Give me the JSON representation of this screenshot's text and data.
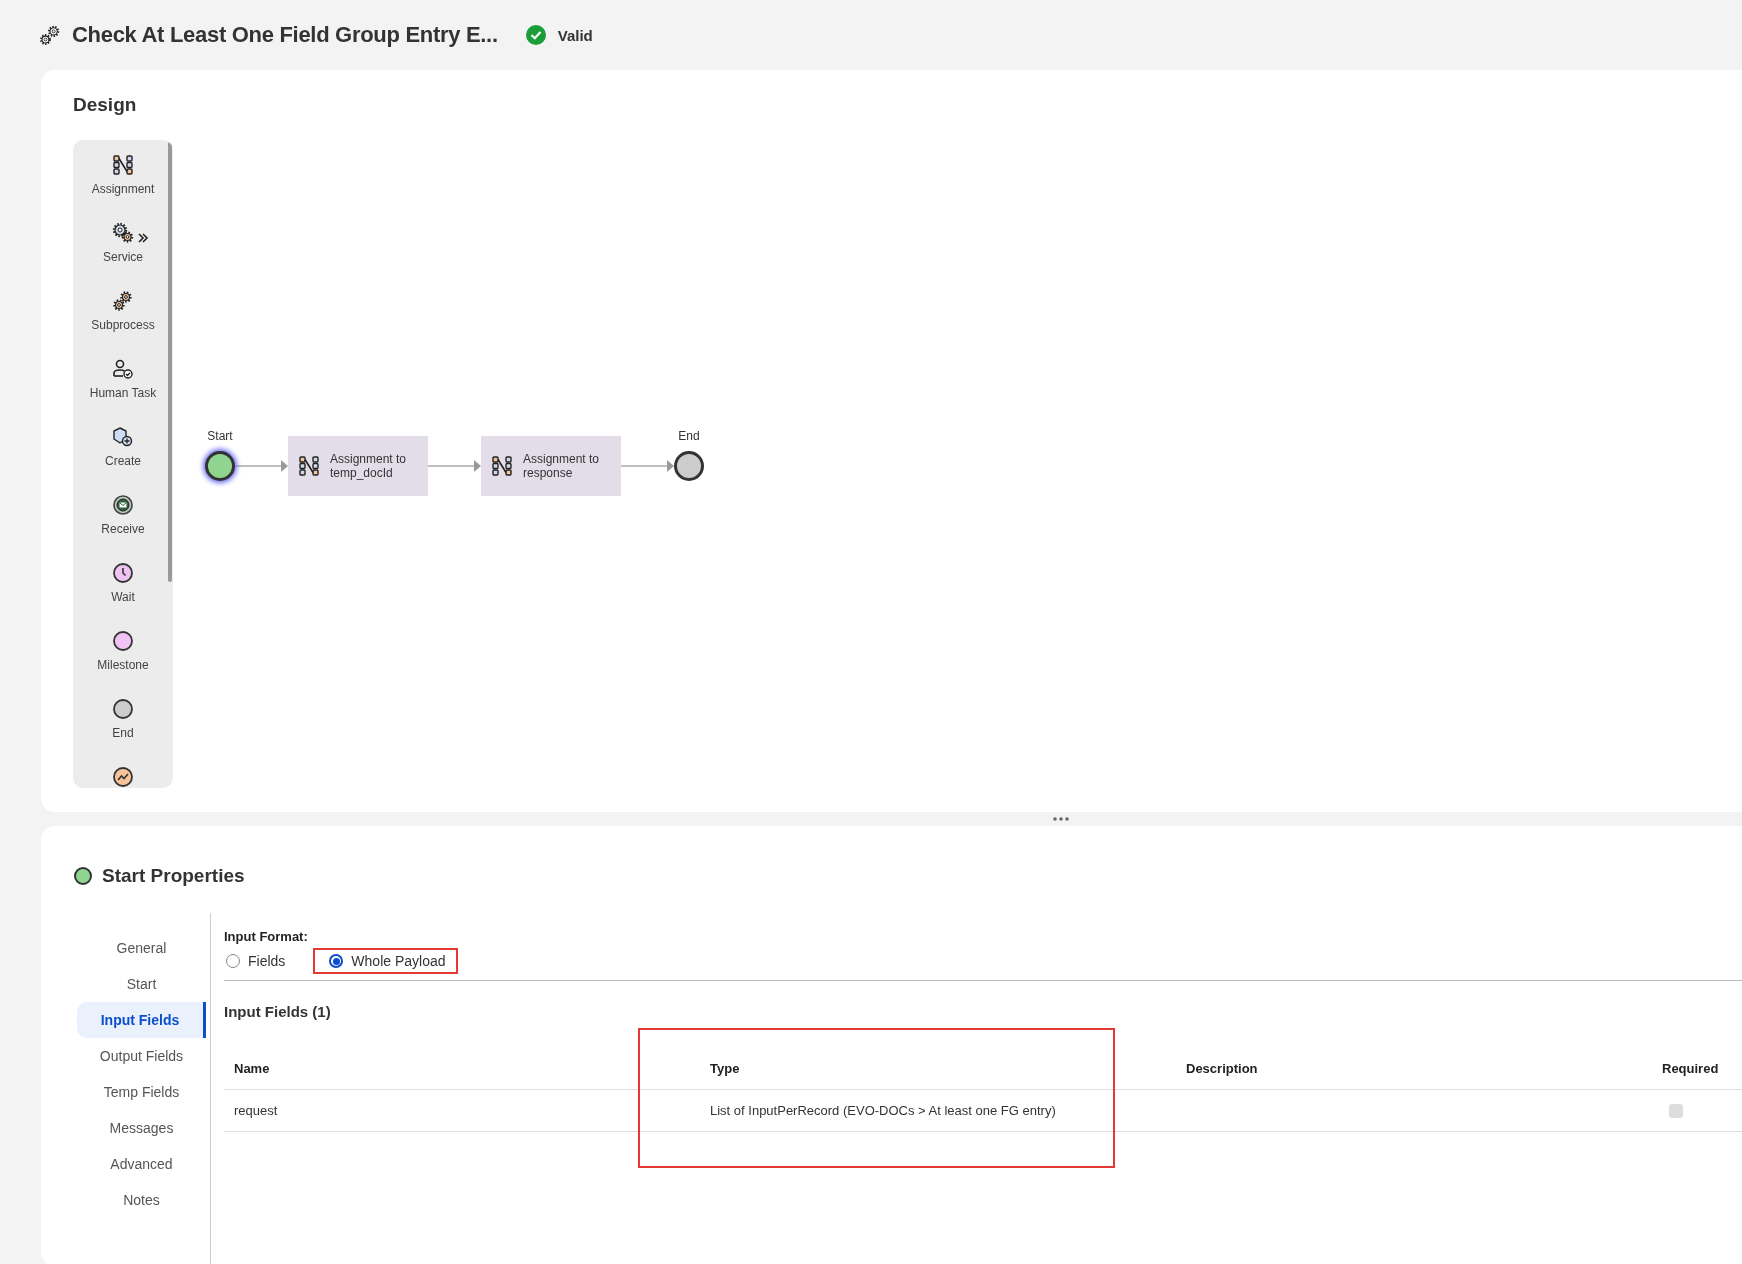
{
  "header": {
    "title": "Check At Least One Field Group Entry E...",
    "status": "Valid",
    "valid": true
  },
  "design": {
    "title": "Design",
    "palette": [
      {
        "kind": "assignment",
        "label": "Assignment",
        "expandable": false
      },
      {
        "kind": "service",
        "label": "Service",
        "expandable": true
      },
      {
        "kind": "subprocess",
        "label": "Subprocess",
        "expandable": false
      },
      {
        "kind": "human_task",
        "label": "Human Task",
        "expandable": false
      },
      {
        "kind": "create",
        "label": "Create",
        "expandable": false
      },
      {
        "kind": "receive",
        "label": "Receive",
        "expandable": false
      },
      {
        "kind": "wait",
        "label": "Wait",
        "expandable": false
      },
      {
        "kind": "milestone",
        "label": "Milestone",
        "expandable": false
      },
      {
        "kind": "end",
        "label": "End",
        "expandable": false
      },
      {
        "kind": "trend",
        "expandable": false
      }
    ],
    "nodes": [
      {
        "kind": "start",
        "label": "Start",
        "selected": true
      },
      {
        "kind": "assignment",
        "label": "Assignment to temp_docId",
        "selected": false
      },
      {
        "kind": "assignment",
        "label": "Assignment to response",
        "selected": false
      },
      {
        "kind": "end",
        "label": "End",
        "selected": false
      }
    ]
  },
  "properties": {
    "title": "Start Properties",
    "nav": [
      {
        "label": "General",
        "selected": false
      },
      {
        "label": "Start",
        "selected": false
      },
      {
        "label": "Input Fields",
        "selected": true
      },
      {
        "label": "Output Fields",
        "selected": false
      },
      {
        "label": "Temp Fields",
        "selected": false
      },
      {
        "label": "Messages",
        "selected": false
      },
      {
        "label": "Advanced",
        "selected": false
      },
      {
        "label": "Notes",
        "selected": false
      }
    ],
    "input_format": {
      "label": "Input Format:",
      "options": [
        {
          "label": "Fields",
          "selected": false,
          "highlighted": false
        },
        {
          "label": "Whole Payload",
          "selected": true,
          "highlighted": true
        }
      ]
    },
    "input_fields": {
      "title": "Input Fields (1)",
      "columns": [
        {
          "label": "Name",
          "highlighted": false
        },
        {
          "label": "Type",
          "highlighted": true
        },
        {
          "label": "Description",
          "highlighted": false
        },
        {
          "label": "Required",
          "highlighted": false
        }
      ],
      "rows": [
        {
          "name": "request",
          "type": "List of InputPerRecord (EVO-DOCs > At least one FG entry)",
          "required": false
        }
      ]
    }
  }
}
